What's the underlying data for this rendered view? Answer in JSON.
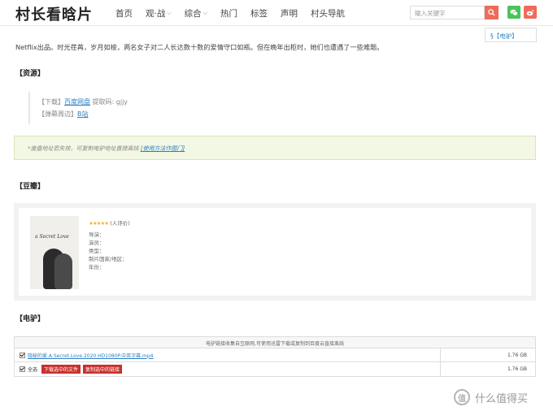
{
  "header": {
    "logo": "村长看晗片",
    "nav": [
      {
        "label": "首页",
        "dropdown": false
      },
      {
        "label": "观·战",
        "dropdown": true
      },
      {
        "label": "综合",
        "dropdown": true
      },
      {
        "label": "热门",
        "dropdown": false
      },
      {
        "label": "标签",
        "dropdown": false
      },
      {
        "label": "声明",
        "dropdown": false
      },
      {
        "label": "村头导航",
        "dropdown": false
      }
    ],
    "search_placeholder": "输入关键字"
  },
  "side_tag": "§【电驴】",
  "intro": "Netflix出品。时光荏苒，岁月如梭，两名女子对二人长达数十数的爱情守口如瓶。但在晚年出柜时，她们也遭遇了一些难题。",
  "sections": {
    "resource": "【资源】",
    "douban": "【豆瓣】",
    "edonkey": "【电驴】"
  },
  "resource": {
    "download_prefix": "【下载】",
    "download_link": "百度网盘",
    "code_label": "提取码: gjjy",
    "danmu_prefix": "【弹幕周边】",
    "danmu_link": "B站"
  },
  "notice": {
    "text": "*度盘地址若失效，可复制电驴地址直接离线",
    "link": "[使用方法作图门]"
  },
  "douban": {
    "poster_title": "a Secret Love",
    "stars": "★★★★★",
    "rating": "(人评价)",
    "fields": [
      "导演：",
      "演员：",
      "类型：",
      "制片国家/地区：",
      "年份："
    ]
  },
  "edonkey": {
    "header": "电驴链接收集自互联网,可使用迅雷下载或复制到百度云直接离线",
    "file_name": "隐秘的爱.A.Secret.Love.2020.HD1080P.中英字幕.mp4",
    "file_size": "1.76 GB",
    "select_all": "全选",
    "download_btn": "下载选中的文件",
    "copy_btn": "复制选中的链接",
    "total_size": "1.76 GB"
  },
  "watermark": "什么值得买"
}
